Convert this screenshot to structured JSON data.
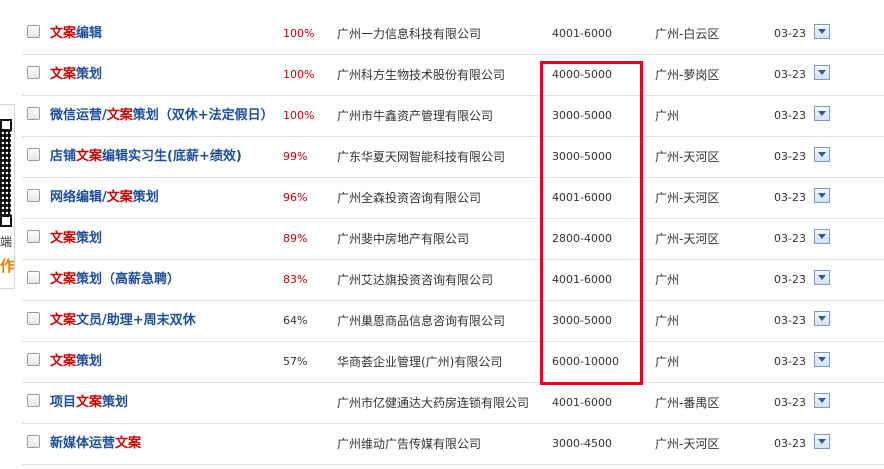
{
  "side_panel": {
    "text_partial": "端",
    "accent_partial": "作"
  },
  "colors": {
    "title_blue": "#1f4e9b",
    "keyword_red": "#cc0000",
    "highlight_box": "#e8001c",
    "side_accent": "#e67e00"
  },
  "jobs": [
    {
      "pre": "",
      "kw": "文案",
      "post": "编辑",
      "match": "100%",
      "company": "广州一力信息科技有限公司",
      "salary": "4001-6000",
      "location": "广州-白云区",
      "date": "03-23"
    },
    {
      "pre": "",
      "kw": "文案",
      "post": "策划",
      "match": "100%",
      "company": "广州科方生物技术股份有限公司",
      "salary": "4000-5000",
      "location": "广州-萝岗区",
      "date": "03-23"
    },
    {
      "pre": "微信运营/",
      "kw": "文案",
      "post": "策划（双休+法定假日）",
      "match": "100%",
      "company": "广州市牛鑫资产管理有限公司",
      "salary": "3000-5000",
      "location": "广州",
      "date": "03-23"
    },
    {
      "pre": "店铺",
      "kw": "文案",
      "post": "编辑实习生(底薪+绩效)",
      "match": "99%",
      "company": "广东华夏天网智能科技有限公司",
      "salary": "3000-5000",
      "location": "广州-天河区",
      "date": "03-23"
    },
    {
      "pre": "网络编辑/",
      "kw": "文案",
      "post": "策划",
      "match": "96%",
      "company": "广州全森投资咨询有限公司",
      "salary": "4001-6000",
      "location": "广州-天河区",
      "date": "03-23"
    },
    {
      "pre": "",
      "kw": "文案",
      "post": "策划",
      "match": "89%",
      "company": "广州斐中房地产有限公司",
      "salary": "2800-4000",
      "location": "广州-天河区",
      "date": "03-23"
    },
    {
      "pre": "",
      "kw": "文案",
      "post": "策划（高薪急聘）",
      "match": "83%",
      "company": "广州艾达旗投资咨询有限公司",
      "salary": "4001-6000",
      "location": "广州",
      "date": "03-23"
    },
    {
      "pre": "",
      "kw": "文案",
      "post": "文员/助理+周末双休",
      "match": "64%",
      "company": "广州巢恩商品信息咨询有限公司",
      "salary": "3000-5000",
      "location": "广州",
      "date": "03-23"
    },
    {
      "pre": "",
      "kw": "文案",
      "post": "策划",
      "match": "57%",
      "company": "华商荟企业管理(广州)有限公司",
      "salary": "6000-10000",
      "location": "广州",
      "date": "03-23"
    },
    {
      "pre": "项目",
      "kw": "文案",
      "post": "策划",
      "match": "",
      "company": "广州市亿健通达大药房连锁有限公司",
      "salary": "4001-6000",
      "location": "广州-番禺区",
      "date": "03-23"
    },
    {
      "pre": "新媒体运营",
      "kw": "文案",
      "post": "",
      "match": "",
      "company": "广州维动广告传媒有限公司",
      "salary": "3000-4500",
      "location": "广州-天河区",
      "date": "03-23"
    }
  ]
}
